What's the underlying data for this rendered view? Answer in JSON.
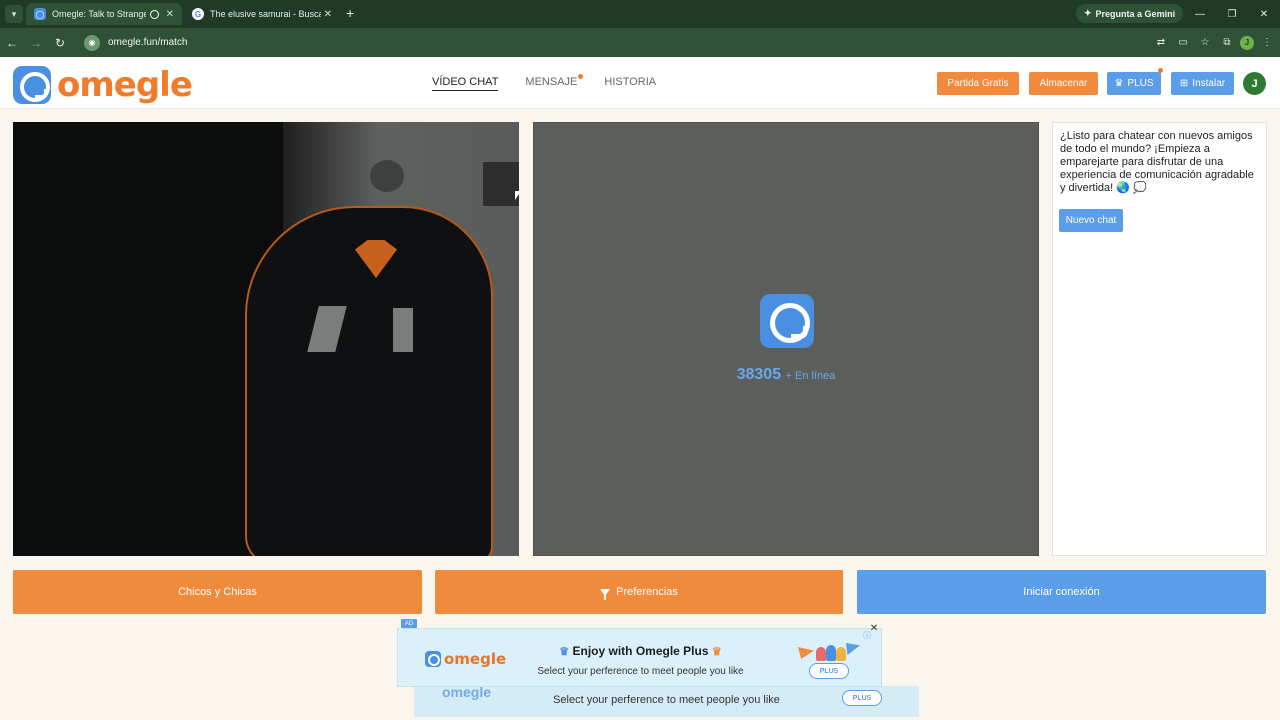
{
  "browser": {
    "tab_list_icon": "chevron-down-icon",
    "tabs": [
      {
        "title": "Omegle: Talk to Strangers! (",
        "active": true
      },
      {
        "title": "The elusive samurai - Buscar co",
        "active": false
      }
    ],
    "new_tab": "+",
    "gemini_label": "Pregunta a Gemini",
    "url": "omegle.fun/match",
    "profile_initial": "J"
  },
  "site": {
    "logo_text": "omegle",
    "nav": [
      {
        "label": "VÍDEO CHAT",
        "active": true
      },
      {
        "label": "MENSAJE",
        "active": false,
        "has_dot": true
      },
      {
        "label": "HISTORIA",
        "active": false
      }
    ],
    "buttons": {
      "free_match": "Partida Gratis",
      "store": "Almacenar",
      "plus": "PLUS",
      "install": "Instalar"
    },
    "avatar_initial": "J"
  },
  "stranger": {
    "online_count": "38305",
    "online_label": "+ En línea"
  },
  "chat": {
    "message": "¿Listo para chatear con nuevos amigos de todo el mundo? ¡Empieza a emparejarte para disfrutar de una experiencia de comunicación agradable y divertida! 🌏 💭",
    "new_chat": "Nuevo chat"
  },
  "actions": {
    "gender": "Chicos y Chicas",
    "preferences": "Preferencias",
    "start": "Iniciar conexión"
  },
  "ad": {
    "badge": "AD",
    "logo_text": "omegle",
    "headline": "Enjoy with Omegle Plus",
    "subline": "Select your perference to meet people you like",
    "plus_pill": "PLUS",
    "back_subline": "Select your perference to meet people you like",
    "back_logo": "omegle"
  },
  "colors": {
    "brand_orange": "#f08a3c",
    "brand_blue": "#5a9de8",
    "chrome_green": "#2f5236"
  }
}
